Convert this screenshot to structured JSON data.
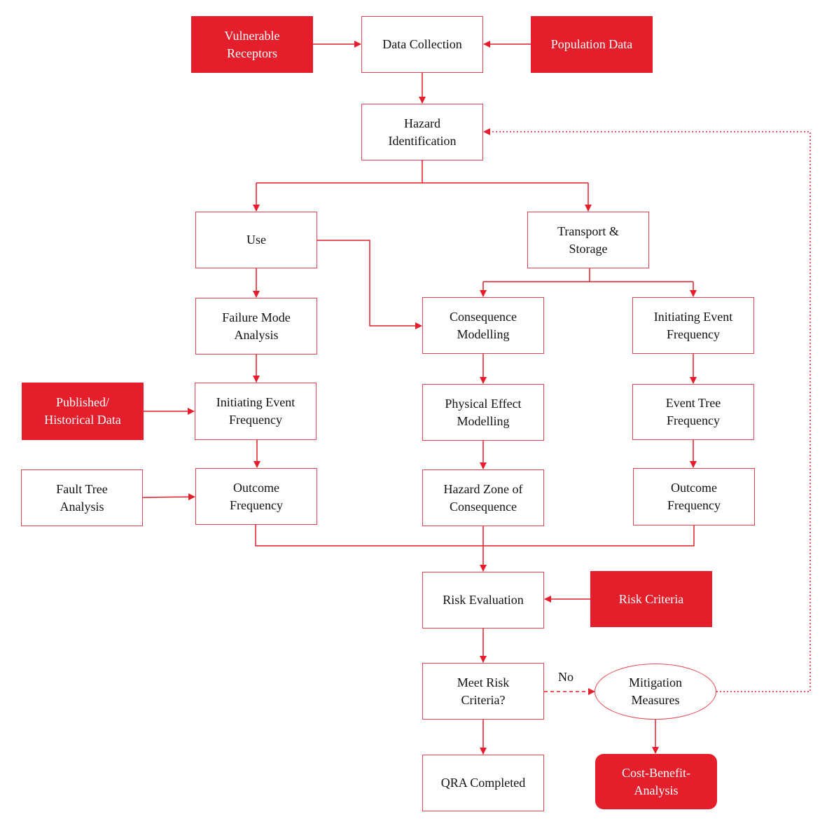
{
  "colors": {
    "accent": "#e41e2b",
    "text": "#111111"
  },
  "nodes": {
    "vulnerable": "Vulnerable\nReceptors",
    "data_collection": "Data Collection",
    "population": "Population Data",
    "hazard_id": "Hazard\nIdentification",
    "use": "Use",
    "transport": "Transport &\nStorage",
    "fmea": "Failure Mode\nAnalysis",
    "consequence": "Consequence\nModelling",
    "ief_right": "Initiating Event\nFrequency",
    "published": "Published/\nHistorical Data",
    "ief_left": "Initiating Event\nFrequency",
    "physical": "Physical Effect\nModelling",
    "event_tree": "Event Tree\nFrequency",
    "fault_tree": "Fault Tree\nAnalysis",
    "outcome_left": "Outcome\nFrequency",
    "hazard_zone": "Hazard Zone of\nConsequence",
    "outcome_right": "Outcome\nFrequency",
    "risk_eval": "Risk Evaluation",
    "risk_criteria": "Risk Criteria",
    "meet": "Meet Risk\nCriteria?",
    "qra": "QRA Completed",
    "mitigation": "Mitigation\nMeasures",
    "cost_benefit": "Cost-Benefit-\nAnalysis"
  },
  "edge_labels": {
    "no": "No"
  }
}
